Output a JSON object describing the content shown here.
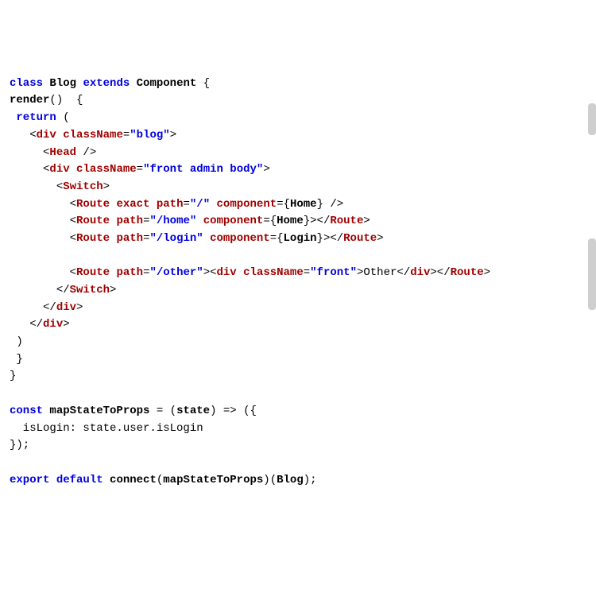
{
  "code": {
    "line1": {
      "kw_class": "class",
      "name_blog": "Blog",
      "kw_extends": "extends",
      "name_component": "Component",
      "brace": " {"
    },
    "line2": {
      "name_render": "render",
      "tail": "()  {"
    },
    "line3": {
      "kw_return": "return",
      "tail": " ("
    },
    "line4": {
      "open": "<",
      "tag_div": "div",
      "sp1": " ",
      "attr_className": "className",
      "eq": "=",
      "str_blog": "\"blog\"",
      "close": ">"
    },
    "line5": {
      "open": "<",
      "tag_head": "Head",
      "close": " />"
    },
    "line6": {
      "open": "<",
      "tag_div": "div",
      "sp1": " ",
      "attr_className": "className",
      "eq": "=",
      "str_front_admin_body": "\"front admin body\"",
      "close": ">"
    },
    "line7": {
      "open": "<",
      "tag_switch": "Switch",
      "close": ">"
    },
    "line8": {
      "open": "<",
      "tag_route": "Route",
      "sp1": " ",
      "attr_exact": "exact",
      "sp2": " ",
      "attr_path": "path",
      "eq1": "=",
      "str_root": "\"/\"",
      "sp3": " ",
      "attr_component": "component",
      "eq2": "={",
      "name_home": "Home",
      "tail": "} />"
    },
    "line9": {
      "open": "<",
      "tag_route": "Route",
      "sp1": " ",
      "attr_path": "path",
      "eq1": "=",
      "str_home": "\"/home\"",
      "sp2": " ",
      "attr_component": "component",
      "eq2": "={",
      "name_home": "Home",
      "mid": "}></",
      "tag_route_close": "Route",
      "close": ">"
    },
    "line10": {
      "open": "<",
      "tag_route": "Route",
      "sp1": " ",
      "attr_path": "path",
      "eq1": "=",
      "str_login": "\"/login\"",
      "sp2": " ",
      "attr_component": "component",
      "eq2": "={",
      "name_login": "Login",
      "mid": "}></",
      "tag_route_close": "Route",
      "close": ">"
    },
    "line12": {
      "open": "<",
      "tag_route": "Route",
      "sp1": " ",
      "attr_path": "path",
      "eq1": "=",
      "str_other": "\"/other\"",
      "mid1": "><",
      "tag_div": "div",
      "sp2": " ",
      "attr_className": "className",
      "eq2": "=",
      "str_front": "\"front\"",
      "mid2": ">Other</",
      "tag_div2": "div",
      "mid3": "></",
      "tag_route_close": "Route",
      "close": ">"
    },
    "line13": {
      "open": "</",
      "tag_switch": "Switch",
      "close": ">"
    },
    "line14": {
      "open": "</",
      "tag_div": "div",
      "close": ">"
    },
    "line15": {
      "open": "</",
      "tag_div": "div",
      "close": ">"
    },
    "line16": {
      "paren": ")"
    },
    "line17": {
      "brace": "}"
    },
    "line18": {
      "brace": "}"
    },
    "line20": {
      "kw_const": "const",
      "sp1": " ",
      "name_map": "mapStateToProps",
      "mid": " = (",
      "name_state": "state",
      "tail": ") => ({"
    },
    "line21": {
      "text": "  isLogin: state.user.isLogin"
    },
    "line22": {
      "text": "});"
    },
    "line24": {
      "kw_export": "export",
      "sp1": " ",
      "kw_default": "default",
      "sp2": " ",
      "name_connect": "connect",
      "open_paren": "(",
      "name_map": "mapStateToProps",
      "mid": ")(",
      "name_blog": "Blog",
      "tail": ");"
    }
  }
}
